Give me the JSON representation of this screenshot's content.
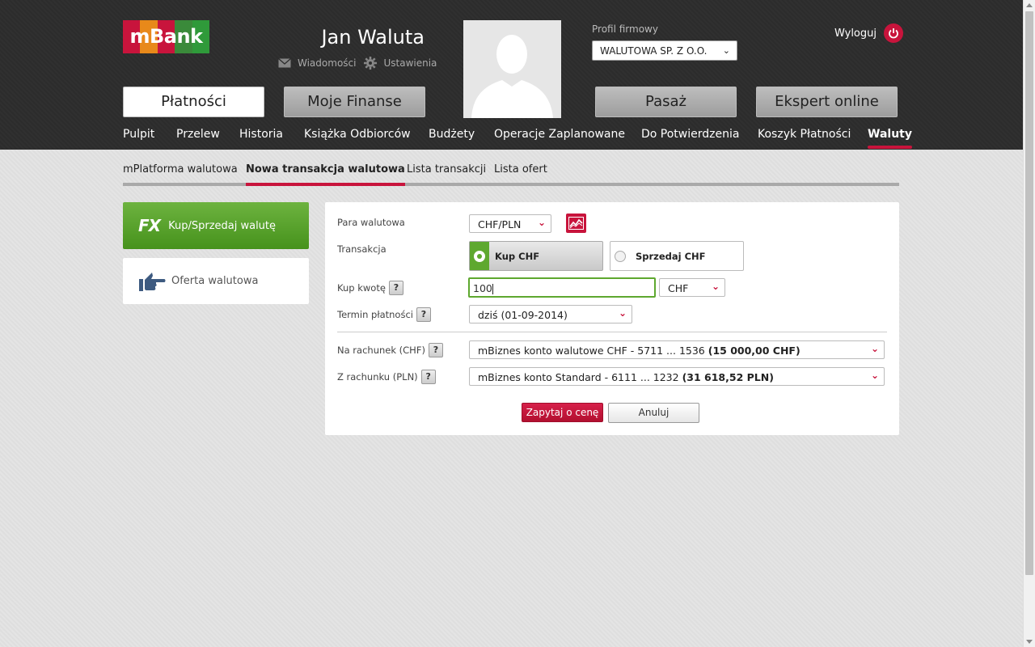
{
  "header": {
    "logo_text": "mBank",
    "logo_colors": [
      "#c8143c",
      "#e8891a",
      "#c8143c",
      "#3a8a3a",
      "#2f9a3a"
    ],
    "user_name": "Jan Waluta",
    "messages_label": "Wiadomości",
    "settings_label": "Ustawienia",
    "profile_label": "Profil firmowy",
    "profile_value": "WALUTOWA SP. Z O.O.",
    "logout_label": "Wyloguj",
    "main_buttons": [
      "Płatności",
      "Moje Finanse",
      "Pasaż",
      "Ekspert online"
    ],
    "active_main": "Płatności"
  },
  "subnav": {
    "items": [
      "Pulpit",
      "Przelew",
      "Historia",
      "Książka Odbiorców",
      "Budżety",
      "Operacje Zaplanowane",
      "Do Potwierdzenia",
      "Koszyk Płatności",
      "Waluty"
    ],
    "active": "Waluty"
  },
  "tabs": {
    "items": [
      "mPlatforma walutowa",
      "Nowa transakcja walutowa",
      "Lista transakcji",
      "Lista ofert"
    ],
    "active": "Nowa transakcja walutowa"
  },
  "side": {
    "fx_icon_text": "FX",
    "fx_label": "Kup/Sprzedaj walutę",
    "offer_label": "Oferta walutowa"
  },
  "form": {
    "pair_label": "Para walutowa",
    "pair_value": "CHF/PLN",
    "transaction_label": "Transakcja",
    "buy_option": "Kup CHF",
    "sell_option": "Sprzedaj CHF",
    "selected_option": "Kup CHF",
    "amount_label": "Kup kwotę",
    "amount_value": "100",
    "amount_currency": "CHF",
    "term_label": "Termin płatności",
    "term_value": "dziś (01-09-2014)",
    "to_account_label": "Na rachunek (CHF)",
    "to_account_value": "mBiznes konto walutowe CHF - 5711 ... 1536",
    "to_account_balance": "(15 000,00 CHF)",
    "from_account_label": "Z rachunku (PLN)",
    "from_account_value": "mBiznes konto Standard - 6111 ... 1232",
    "from_account_balance": "(31 618,52 PLN)",
    "help_glyph": "?",
    "submit_label": "Zapytaj o cenę",
    "cancel_label": "Anuluj"
  },
  "colors": {
    "accent": "#c8143c",
    "green": "#5ea82f",
    "header_bg": "#2d2d2d"
  }
}
